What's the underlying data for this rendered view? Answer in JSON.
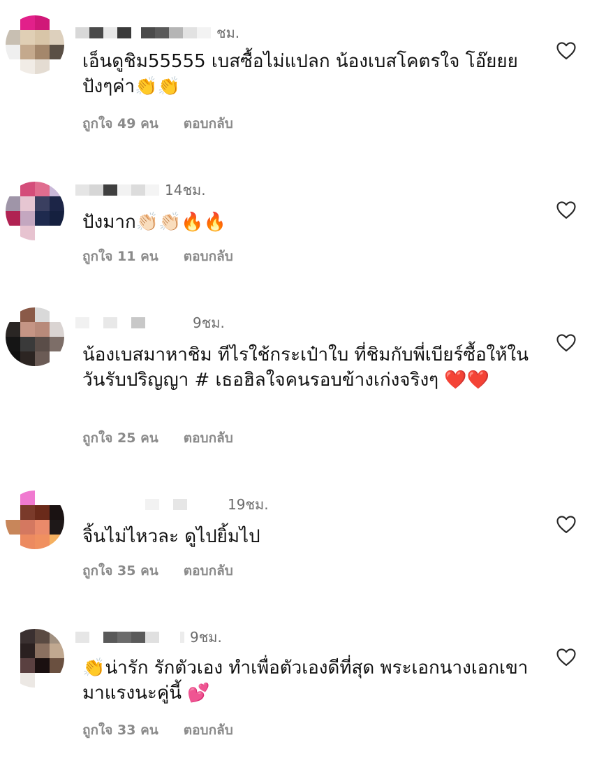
{
  "comments": [
    {
      "time": "ชม.",
      "text": "เอ็นดูชิม55555 เบสซื้อไม่แปลก น้องเบสโคตรใจ โอ๊ยยยปังๆค่า👏👏",
      "likes": "ถูกใจ 49 คน",
      "reply": "ตอบกลับ"
    },
    {
      "time": "14ชม.",
      "text": "ปังมาก👏🏻👏🏻🔥🔥",
      "likes": "ถูกใจ 11 คน",
      "reply": "ตอบกลับ"
    },
    {
      "time": "9ชม.",
      "text": "น้องเบสมาหาชิม ทีไรใช้กระเป๋าใบ ที่ชิมกับพี่เบียร์ซื้อให้ในวันรับปริญญา # เธอฮิลใจคนรอบข้างเก่งจริงๆ ❤️❤️",
      "likes": "ถูกใจ 25 คน",
      "reply": "ตอบกลับ"
    },
    {
      "time": "19ชม.",
      "text": "จิ้นไม่ไหวละ ดูไปยิ้มไป",
      "likes": "ถูกใจ 35 คน",
      "reply": "ตอบกลับ"
    },
    {
      "time": "9ชม.",
      "text": "👏น่ารัก รักตัวเอง ทำเพื่อตัวเองดีที่สุด พระเอกนางเอกเขามาแรงนะคู่นี้ 💕",
      "likes": "ถูกใจ 33 คน",
      "reply": "ตอบกลับ"
    }
  ],
  "icons": {
    "like": "heart-outline-icon"
  },
  "colors": {
    "meta": "#8a8a8a",
    "time": "#6b6b6b",
    "text": "#111111"
  }
}
